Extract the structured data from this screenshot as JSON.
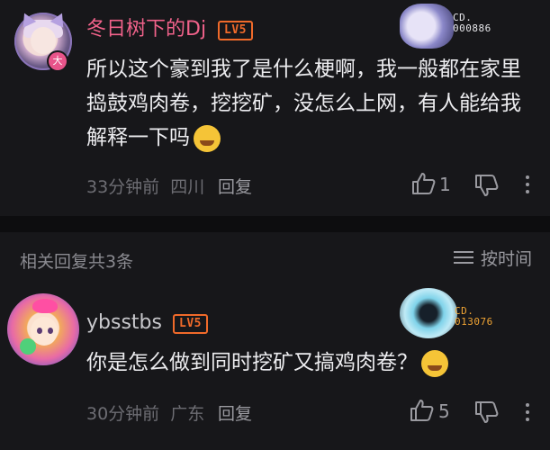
{
  "comment1": {
    "username": "冬日树下的Dj",
    "level": "LV5",
    "fan_number": "CD.\n000886",
    "text": "所以这个豪到我了是什么梗啊，我一般都在家里捣鼓鸡肉卷，挖挖矿，没怎么上网，有人能给我解释一下吗",
    "time": "33分钟前",
    "location": "四川",
    "reply_label": "回复",
    "like_count": "1",
    "avatar_badge": "大"
  },
  "replies_section": {
    "title": "相关回复共3条",
    "sort_label": "按时间"
  },
  "comment2": {
    "username": "ybsstbs",
    "level": "LV5",
    "fan_number": "CD.\n013076",
    "text": "你是怎么做到同时挖矿又搞鸡肉卷？",
    "time": "30分钟前",
    "location": "广东",
    "reply_label": "回复",
    "like_count": "5"
  },
  "colors": {
    "background": "#17171a",
    "username_vip": "#f0628a",
    "level_badge": "#f06a2a",
    "fan_number_gold": "#f0a434",
    "meta_text": "#6d6d73"
  }
}
